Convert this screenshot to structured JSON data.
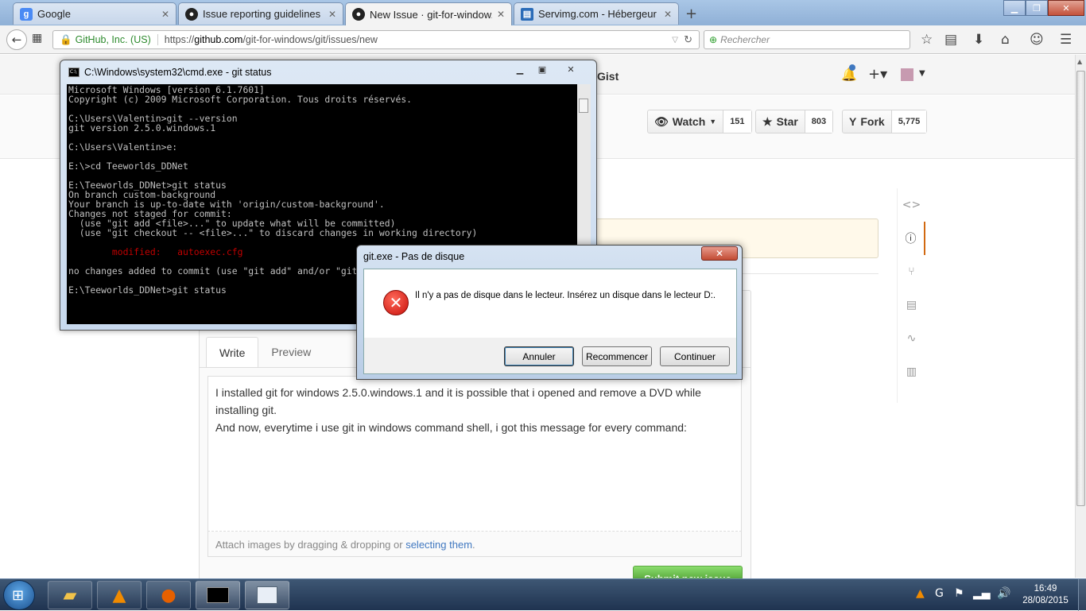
{
  "browser": {
    "tabs": [
      {
        "title": "Google",
        "icon": "google-icon"
      },
      {
        "title": "Issue reporting guidelines ...",
        "icon": "github-icon"
      },
      {
        "title": "New Issue · git-for-window...",
        "icon": "github-icon",
        "active": true
      },
      {
        "title": "Servimg.com - Hébergeur ...",
        "icon": "servimg-icon"
      }
    ],
    "identity": "GitHub, Inc. (US)",
    "url_prefix": "https://",
    "url_domain": "github.com",
    "url_path": "/git-for-windows/git/issues/new",
    "search_placeholder": "Rechercher"
  },
  "github": {
    "header_gist": "Gist",
    "watch": {
      "label": "Watch",
      "count": "151"
    },
    "star": {
      "label": "Star",
      "count": "803"
    },
    "fork": {
      "label": "Fork",
      "count": "5,775"
    },
    "tabs": {
      "write": "Write",
      "preview": "Preview"
    },
    "body_lines": [
      "I installed git for windows 2.5.0.windows.1 and it is possible that i opened and remove a DVD while",
      "installing git.",
      "And now, everytime i use git in windows command shell, i got this message for every command:"
    ],
    "attach_prefix": "Attach images by dragging & dropping or ",
    "attach_link": "selecting them",
    "attach_suffix": ".",
    "submit": "Submit new issue"
  },
  "cmd": {
    "title": "C:\\Windows\\system32\\cmd.exe - git  status",
    "lines_before": "Microsoft Windows [version 6.1.7601]\nCopyright (c) 2009 Microsoft Corporation. Tous droits réservés.\n\nC:\\Users\\Valentin>git --version\ngit version 2.5.0.windows.1\n\nC:\\Users\\Valentin>e:\n\nE:\\>cd Teeworlds_DDNet\n\nE:\\Teeworlds_DDNet>git status\nOn branch custom-background\nYour branch is up-to-date with 'origin/custom-background'.\nChanges not staged for commit:\n  (use \"git add <file>...\" to update what will be committed)\n  (use \"git checkout -- <file>...\" to discard changes in working directory)\n",
    "modified_line": "\n        modified:   autoexec.cfg\n",
    "lines_after": "\nno changes added to commit (use \"git add\" and/or \"git commit -a\")\n\nE:\\Teeworlds_DDNet>git status"
  },
  "dialog": {
    "title": "git.exe - Pas de disque",
    "message": "Il n'y a pas de disque dans le lecteur. Insérez un disque dans le lecteur D:.",
    "buttons": {
      "cancel": "Annuler",
      "retry": "Recommencer",
      "continue": "Continuer"
    }
  },
  "taskbar": {
    "time": "16:49",
    "date": "28/08/2015"
  },
  "colors": {
    "github_link": "#4078c0",
    "submit_green": "#60b044",
    "error_red": "#c8100a",
    "console_modified": "#c00000"
  }
}
